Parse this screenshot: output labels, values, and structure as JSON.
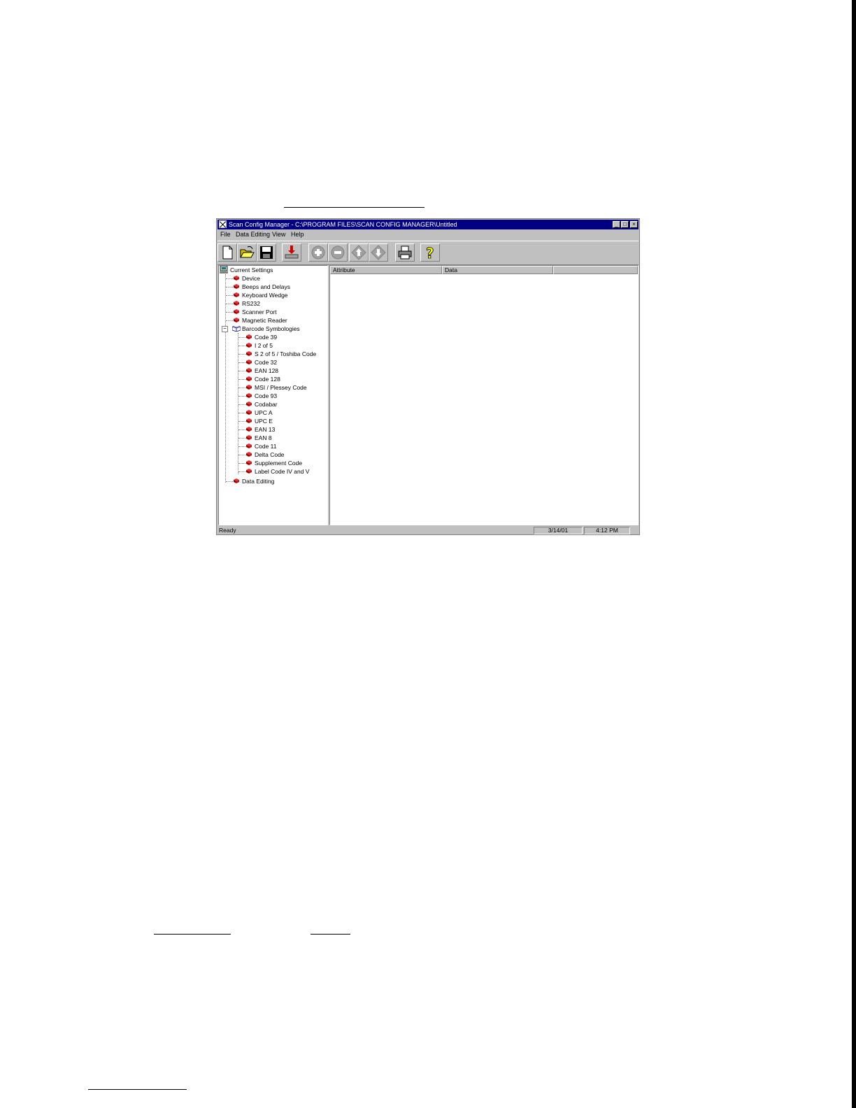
{
  "window": {
    "title": "Scan Config Manager - C:\\PROGRAM FILES\\SCAN CONFIG MANAGER\\Untitled",
    "controls": [
      "_",
      "□",
      "×"
    ]
  },
  "menu": [
    "File",
    "Data Editing",
    "View",
    "Help"
  ],
  "toolbar": [
    "new-icon",
    "open-folder-icon",
    "save-disk-icon",
    "download-to-scanner-icon",
    "add-icon",
    "remove-icon",
    "move-up-icon",
    "move-down-icon",
    "print-icon",
    "help-icon"
  ],
  "tree": {
    "root": "Current Settings",
    "items": [
      "Device",
      "Beeps and Delays",
      "Keyboard Wedge",
      "RS232",
      "Scanner Port",
      "Magnetic Reader"
    ],
    "group": "Barcode Symbologies",
    "expander": "−",
    "children": [
      "Code 39",
      "I 2 of 5",
      "S 2 of 5 / Toshiba Code",
      "Code 32",
      "EAN 128",
      "Code 128",
      "MSI / Plessey Code",
      "Code 93",
      "Codabar",
      "UPC A",
      "UPC E",
      "EAN 13",
      "EAN 8",
      "Code 11",
      "Delta Code",
      "Supplement Code",
      "Label Code IV and V"
    ],
    "last": "Data Editing"
  },
  "list": {
    "columns": [
      "Attribute",
      "Data",
      ""
    ]
  },
  "status": {
    "text": "Ready",
    "date": "3/14/01",
    "time": "4:12 PM"
  },
  "colors": {
    "titlebar": "#000080",
    "face": "#c0c0c0",
    "book": "#b01010"
  }
}
